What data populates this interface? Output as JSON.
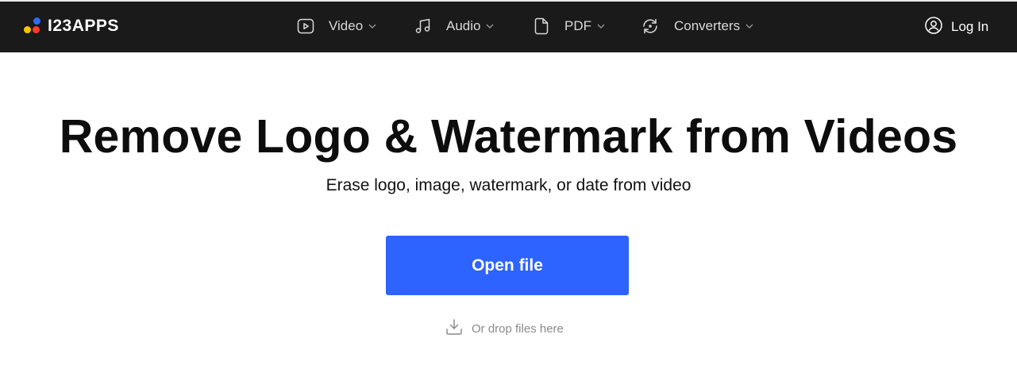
{
  "brand": {
    "name": "I23APPS"
  },
  "nav": {
    "items": [
      {
        "label": "Video",
        "icon": "video-play-icon"
      },
      {
        "label": "Audio",
        "icon": "music-note-icon"
      },
      {
        "label": "PDF",
        "icon": "document-icon"
      },
      {
        "label": "Converters",
        "icon": "convert-arrows-icon"
      }
    ],
    "login_label": "Log In"
  },
  "main": {
    "title": "Remove Logo & Watermark from Videos",
    "subtitle": "Erase logo, image, watermark, or date from video",
    "open_button_label": "Open file",
    "drop_label": "Or drop files here"
  },
  "colors": {
    "topbar": "#1a1a1a",
    "accent": "#2d63ff",
    "logo_blue": "#2f6bff",
    "logo_yellow": "#ffc300",
    "logo_red": "#ff3b30"
  }
}
